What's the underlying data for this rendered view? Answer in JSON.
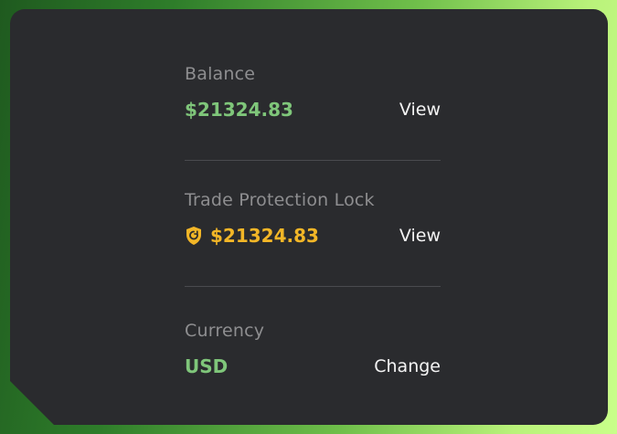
{
  "balance": {
    "label": "Balance",
    "value": "$21324.83",
    "action_label": "View"
  },
  "trade_protection": {
    "label": "Trade Protection Lock",
    "value": "$21324.83",
    "action_label": "View",
    "icon": "shield-icon"
  },
  "currency": {
    "label": "Currency",
    "value": "USD",
    "action_label": "Change"
  },
  "colors": {
    "card_bg": "#2a2b2e",
    "value_green": "#7fc67a",
    "value_gold": "#f2b627",
    "label_gray": "#8e8e90"
  }
}
